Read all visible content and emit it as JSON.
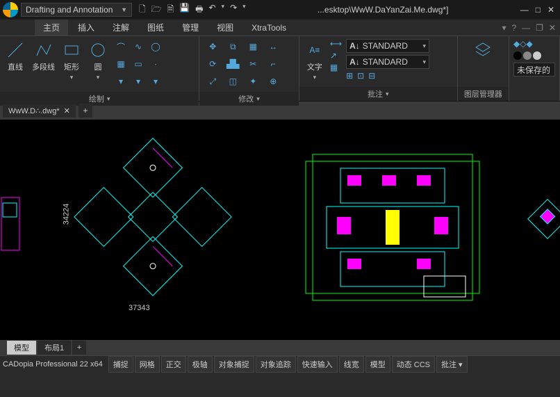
{
  "titlebar": {
    "workspace": "Drafting and Annotation",
    "title": "...esktop\\WwW.DaYanZai.Me.dwg*]"
  },
  "ribbon": {
    "tabs": [
      "主页",
      "插入",
      "注解",
      "图纸",
      "管理",
      "视图",
      "XtraTools"
    ],
    "active": 0,
    "panels": {
      "draw": {
        "title": "绘制",
        "items": [
          "直线",
          "多段线",
          "矩形",
          "圆"
        ]
      },
      "modify": {
        "title": "修改"
      },
      "annotate": {
        "title": "批注",
        "text": "文字",
        "style1": "STANDARD",
        "style2": "STANDARD"
      },
      "layers": {
        "title": "图层管理器",
        "state": "未保存的"
      }
    }
  },
  "doc": {
    "tab": "WwW.D∴.dwg*"
  },
  "dims": {
    "h": "34224",
    "w": "37343"
  },
  "model_tabs": [
    "模型",
    "布局1"
  ],
  "status": {
    "app": "CADopia Professional 22 x64",
    "buttons": [
      "捕捉",
      "网格",
      "正交",
      "极轴",
      "对象捕捉",
      "对象追踪",
      "快速输入",
      "线宽",
      "模型",
      "动态 CCS",
      "批注"
    ]
  }
}
